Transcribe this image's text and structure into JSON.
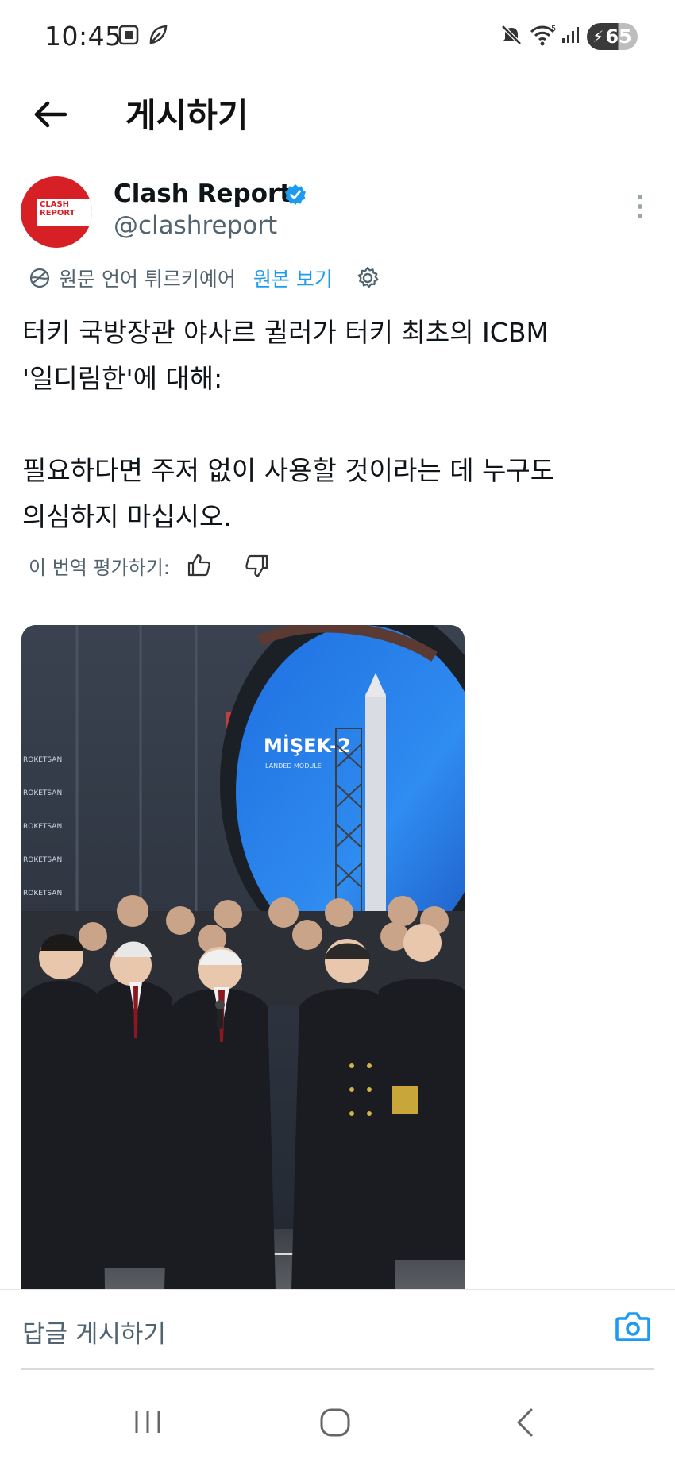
{
  "status_bar": {
    "time": "10:45",
    "battery": "65"
  },
  "header": {
    "title": "게시하기"
  },
  "post": {
    "author_name": "Clash Report",
    "author_handle": "@clashreport",
    "avatar_text": "CLASH REPORT",
    "translated_label": "원문 언어 튀르키예어",
    "view_original": "원본 보기",
    "text": "터키 국방장관 야사르 귈러가 터키 최초의 ICBM\n'일디림한'에 대해:\n\n필요하다면 주저 없이 사용할 것이라는 데 누구도\n의심하지 마십시오.",
    "rate_label": "이 번역 평가하기:"
  },
  "media": {
    "screen_text": "MİŞEK-2",
    "screen_sub": "LANDED MODULE",
    "sponsor_text": "ROKETSAN"
  },
  "reply_bar": {
    "placeholder": "답글 게시하기"
  },
  "colors": {
    "accent": "#1d9bf0",
    "brand_red": "#d71f26",
    "text": "#0f1419",
    "muted": "#536471"
  }
}
